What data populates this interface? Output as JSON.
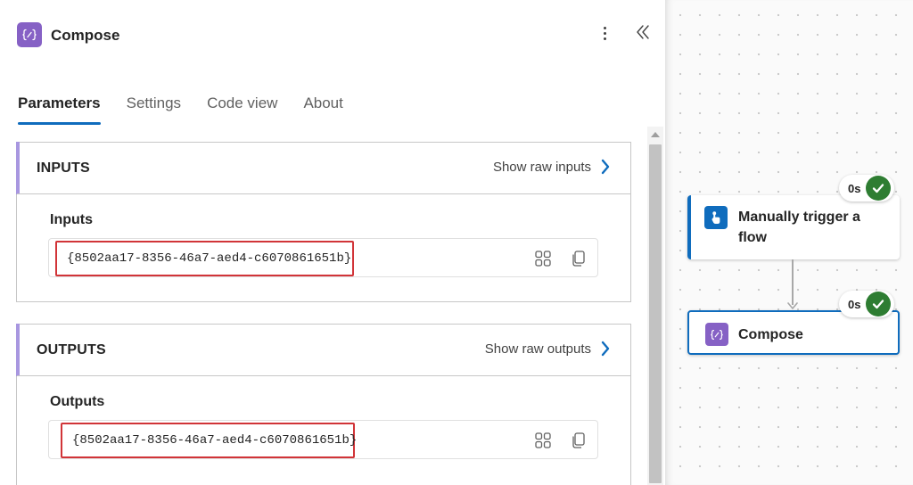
{
  "panel": {
    "title": "Compose",
    "tabs": [
      {
        "label": "Parameters",
        "active": true
      },
      {
        "label": "Settings",
        "active": false
      },
      {
        "label": "Code view",
        "active": false
      },
      {
        "label": "About",
        "active": false
      }
    ],
    "inputs": {
      "header": "INPUTS",
      "raw_link": "Show raw inputs",
      "field_label": "Inputs",
      "value": "{8502aa17-8356-46a7-aed4-c6070861651b}"
    },
    "outputs": {
      "header": "OUTPUTS",
      "raw_link": "Show raw outputs",
      "field_label": "Outputs",
      "value": "{8502aa17-8356-46a7-aed4-c6070861651b}"
    }
  },
  "canvas": {
    "nodes": [
      {
        "label": "Manually trigger a flow",
        "duration": "0s",
        "status": "succeeded"
      },
      {
        "label": "Compose",
        "duration": "0s",
        "status": "succeeded",
        "selected": true
      }
    ]
  },
  "colors": {
    "accent_blue": "#0f6cbd",
    "compose_purple": "#8661c5",
    "success_green": "#2e7d32",
    "highlight_red": "#d13438"
  },
  "icons": {
    "compose": "curly-braces-icon",
    "trigger": "touch-hand-icon",
    "more": "more-vertical-icon",
    "collapse": "double-chevron-left-icon",
    "expand_value": "grid-icon",
    "copy_value": "copy-icon",
    "status": "checkmark-circle-icon"
  }
}
